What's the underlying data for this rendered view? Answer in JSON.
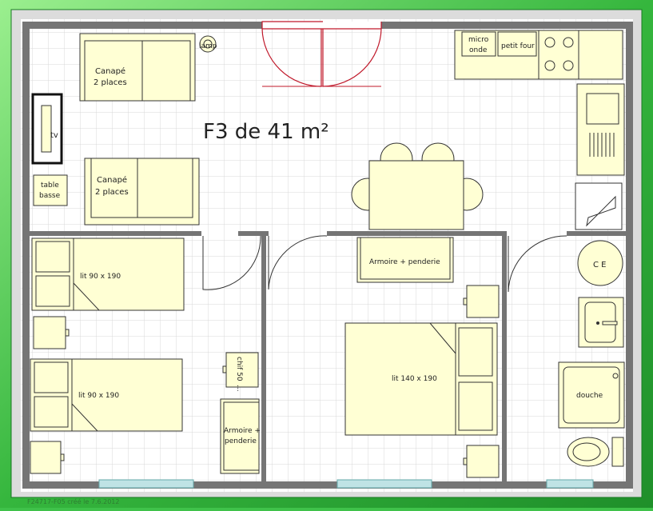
{
  "title": "F3 de 41 m²",
  "footer": "F24717-F05 créé le 7.6.2012",
  "labels": {
    "lamp": "lamp",
    "sofa_top_1": "Canapé",
    "sofa_top_2": "2 places",
    "sofa_bottom_1": "Canapé",
    "sofa_bottom_2": "2 places",
    "tv": "tv",
    "table_1": "table",
    "table_2": "basse",
    "micro_1": "micro",
    "micro_2": "onde",
    "oven": "petit four",
    "bed_a": "lit 90 x 190",
    "bed_b": "lit 90 x 190",
    "chest_1": "chif 50",
    "chest_2": "...",
    "wardrobe_a_1": "Armoire +",
    "wardrobe_a_2": "penderie",
    "wardrobe_b": "Armoire + penderie",
    "bed_double": "lit 140 x 190",
    "boiler": "C E",
    "shower": "douche"
  },
  "colors": {
    "frame": "#3fc24a",
    "wall": "#757575",
    "furniture": "#ffffd4",
    "grid": "#d6d6d6",
    "window": "#bfe3e5",
    "french_door": "#c0182a"
  }
}
